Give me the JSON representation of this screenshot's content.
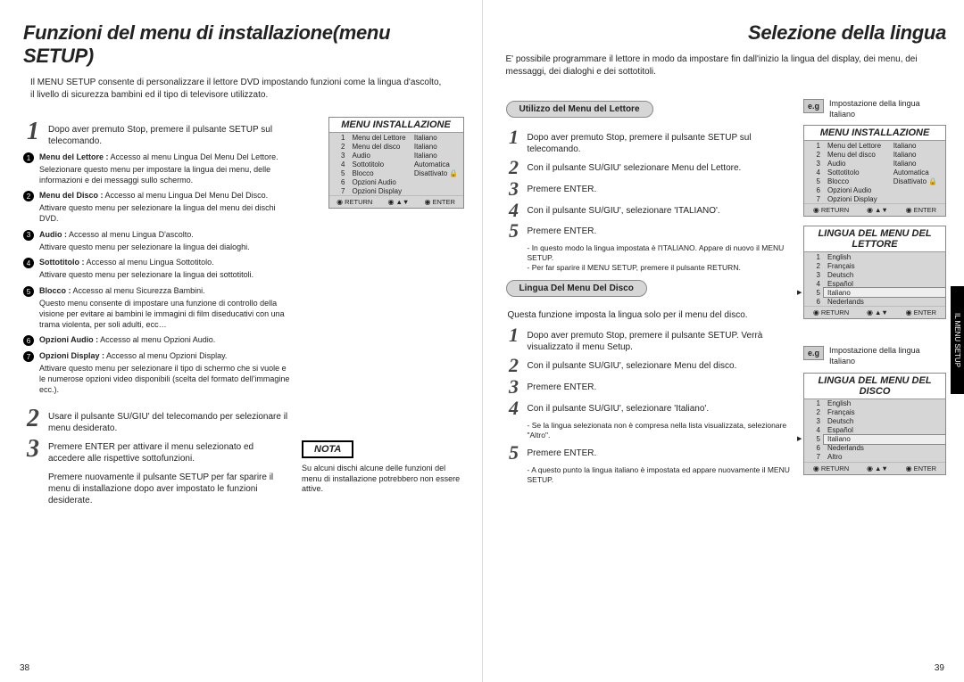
{
  "left": {
    "title": "Funzioni del menu di installazione(menu SETUP)",
    "intro": "Il MENU SETUP consente di personalizzare il lettore DVD impostando funzioni come la lingua d'ascolto, il livello di sicurezza bambini ed il tipo di televisore utilizzato.",
    "step1": "Dopo aver premuto Stop, premere il pulsante SETUP sul telecomando.",
    "bullets": [
      {
        "t": "Menu del Lettore :",
        "r": "Accesso al menu Lingua Del Menu Del Lettore.",
        "d": "Selezionare questo menu per impostare la lingua dei menu, delle informazioni e dei messaggi sullo schermo."
      },
      {
        "t": "Menu del Disco :",
        "r": "Accesso al menu Lingua Del Menu Del Disco.",
        "d": "Attivare questo menu per selezionare la lingua del menu dei dischi DVD."
      },
      {
        "t": "Audio :",
        "r": "Accesso al menu Lingua D'ascolto.",
        "d": "Attivare questo menu per selezionare la lingua dei dialoghi."
      },
      {
        "t": "Sottotitolo :",
        "r": "Accesso al menu Lingua Sottotitolo.",
        "d": "Attivare questo menu per selezionare la lingua dei sottotitoli."
      },
      {
        "t": "Blocco :",
        "r": "Accesso al menu Sicurezza Bambini.",
        "d": "Questo menu consente di impostare una funzione di controllo della visione per evitare ai bambini le immagini di film diseducativi con una trama violenta, per soli adulti, ecc…"
      },
      {
        "t": "Opzioni Audio :",
        "r": "Accesso al menu Opzioni Audio.",
        "d": ""
      },
      {
        "t": "Opzioni Display :",
        "r": "Accesso al menu Opzioni Display.",
        "d": "Attivare questo menu per selezionare il tipo di schermo che si vuole e le numerose opzioni video disponibili (scelta del formato dell'immagine ecc.)."
      }
    ],
    "step2": "Usare il pulsante SU/GIU' del telecomando per selezionare il menu desiderato.",
    "step3": "Premere ENTER per attivare il menu selezionato ed accedere alle rispettive sottofunzioni.",
    "step3b": "Premere nuovamente il pulsante SETUP per far sparire il menu di installazione dopo aver impostato le funzioni desiderate.",
    "nota": "NOTA",
    "notatxt": "Su alcuni dischi alcune delle funzioni del menu di installazione potrebbero non essere attive.",
    "pnum": "38"
  },
  "right": {
    "title": "Selezione della lingua",
    "intro": "E' possibile programmare il lettore in modo da impostare fin dall'inizio la lingua del display, dei menu, dei messaggi, dei dialoghi e dei sottotitoli.",
    "sec1": "Utilizzo del Menu del Lettore",
    "s1": [
      "Dopo aver premuto Stop, premere il pulsante SETUP sul telecomando.",
      "Con il pulsante SU/GIU' selezionare Menu del Lettore.",
      "Premere ENTER.",
      "Con il pulsante SU/GIU', selezionare 'ITALIANO'.",
      "Premere ENTER."
    ],
    "s1n": [
      "- In questo modo la lingua impostata è l'ITALIANO. Appare di nuovo il MENU SETUP.",
      "- Per far sparire il MENU SETUP, premere il pulsante RETURN."
    ],
    "sec2": "Lingua Del Menu Del Disco",
    "sec2i": "Questa funzione imposta la lingua solo per il menu del disco.",
    "s2": [
      "Dopo aver premuto Stop, premere il pulsante SETUP. Verrà visualizzato il menu Setup.",
      "Con il pulsante SU/GIU', selezionare Menu del disco.",
      "Premere ENTER.",
      "Con il pulsante SU/GIU', selezionare 'Italiano'."
    ],
    "s2n": [
      "- Se la lingua selezionata non è compresa nella lista visualizzata, selezionare \"Altro\"."
    ],
    "s2_5": "Premere ENTER.",
    "s2n2": [
      "- A questo punto la lingua italiano è impostata ed appare nuovamente il MENU SETUP."
    ],
    "eg": "e.g",
    "egt": "Impostazione della lingua Italiano",
    "tab": "IL MENU SETUP",
    "pnum": "39"
  },
  "osd": {
    "title": "MENU INSTALLAZIONE",
    "rows": [
      [
        "1",
        "Menu del Lettore",
        "Italiano"
      ],
      [
        "2",
        "Menu del disco",
        "Italiano"
      ],
      [
        "3",
        "Audio",
        "Italiano"
      ],
      [
        "4",
        "Sottotitolo",
        "Automatica"
      ],
      [
        "5",
        "Blocco",
        "Disattivato 🔒"
      ],
      [
        "6",
        "Opzioni Audio",
        ""
      ],
      [
        "7",
        "Opzioni Display",
        ""
      ]
    ],
    "ret": "RETURN",
    "ud": "▲▼",
    "ent": "ENTER",
    "lettore": {
      "title": "LINGUA DEL MENU DEL LETTORE",
      "rows": [
        [
          "1",
          "English"
        ],
        [
          "2",
          "Français"
        ],
        [
          "3",
          "Deutsch"
        ],
        [
          "4",
          "Español"
        ],
        [
          "5",
          "Italiano"
        ],
        [
          "6",
          "Nederlands"
        ]
      ],
      "sel": 4
    },
    "disco": {
      "title": "LINGUA DEL MENU DEL DISCO",
      "rows": [
        [
          "1",
          "English"
        ],
        [
          "2",
          "Français"
        ],
        [
          "3",
          "Deutsch"
        ],
        [
          "4",
          "Español"
        ],
        [
          "5",
          "Italiano"
        ],
        [
          "6",
          "Nederlands"
        ],
        [
          "7",
          "Altro"
        ]
      ],
      "sel": 4
    }
  }
}
